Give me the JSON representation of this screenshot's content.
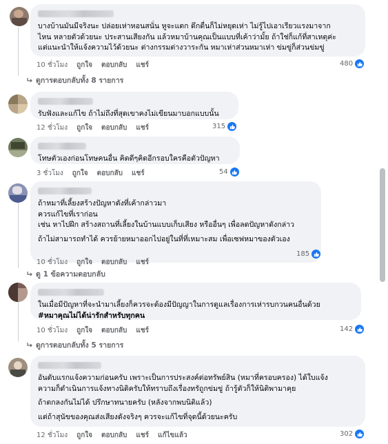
{
  "comments": [
    {
      "paragraphs": [
        "บางบ้านมันมีจริงนะ ปล่อยเห่าหอนสนั่น หูจะแตก ดึกดื่นก็ไม่หยุดเห่า ไม่รู้ไปเอาเรียวแรงมาจาก\nไหน หลายตัวด้วยนะ ประสานเสียงกัน แล้วหมาบ้านคุณเป็นแบบที่เค้าว่ามั้ย ถ้าใช่ก็แก้ที่สาเหตุค่ะ\nแต่แนะนำให้แจ้งความไว้ด้วยนะ ต่างกรรมต่างวาระกัน หมาเห่าส่วนหมาเห่า ข่มขู่ก็ส่วนข่มขู่"
      ],
      "time": "10 ชั่วโมง",
      "like": "ถูกใจ",
      "reply": "ตอบกลับ",
      "share": "แชร์",
      "reactions": "480",
      "more_replies": "ดูการตอบกลับทั้ง 8 รายการ"
    },
    {
      "paragraphs": [
        "รับฟังและแก้ไข ถ้าไม่ถึงที่สุดเขาคงไม่เขียนมาบอกแบบนั้น"
      ],
      "time": "12 ชั่วโมง",
      "like": "ถูกใจ",
      "reply": "ตอบกลับ",
      "share": "แชร์",
      "reactions": "315"
    },
    {
      "paragraphs": [
        "โทษตัวเองก่อนโทษคนอื่น คิดดีๆคิดอีกรอบใครคือตัวปัญหา"
      ],
      "time": "3 ชั่วโมง",
      "like": "ถูกใจ",
      "reply": "ตอบกลับ",
      "share": "แชร์",
      "reactions": "54"
    },
    {
      "paragraphs": [
        "ถ้าหมาที่เลี้ยงสร้างปัญหาดังที่เค้ากล่าวมา\nควรแก้ไขที่เราก่อน\nเช่น หาไปฝึก สร้างสถานที่เลี้ยงในบ้านแบบเก็บเสียง หรืออื่นๆ เพื่อลดปัญหาดังกล่าว",
        "ถ้าไม่สามารถทำได้ ควรย้ายหมาออกไปอยู่ในที่ที่เหมาะสม เพื่อเซฟหมาของตัวเอง"
      ],
      "time": "10 ชั่วโมง",
      "like": "ถูกใจ",
      "reply": "ตอบกลับ",
      "share": "แชร์",
      "reactions": "185",
      "more_replies": "ดู 1 ข้อความตอบกลับ"
    },
    {
      "paragraphs": [
        "ในเมื่อมีปัญหาที่จะนำมาเลี้ยงก็ควรจะต้องมีปัญญาในการดูแลเรื่องการเห่ารบกวนคนอื่นด้วย"
      ],
      "hashtag": "#หมาคุณไม่ได้น่ารักสำหรับทุกคน",
      "time": "10 ชั่วโมง",
      "like": "ถูกใจ",
      "reply": "ตอบกลับ",
      "share": "แชร์",
      "reactions": "142",
      "more_replies": "ดูการตอบกลับทั้ง 5 รายการ"
    },
    {
      "paragraphs": [
        "อันดับแรกแจ้งความก่อนครับ เพราะเป็นการประสงค์ต่อทรัพย์สิน (หมาที่ครอบครอง) ได้ใบแจ้ง\nความก็ดำเนินการแจ้งทางนิติครับให้ทราบถึงเรื่องทรัถูกข่มขู่ ถ้ารู้ตัวก็ให้นิติพามาคุย",
        "ถ้าตกลงกันไม่ได้ ปรึกษาทนายครับ (หลังจากพบนิติแล้ว)",
        "แต่ถ้าสุนัขของคุณส่งเสียงดังจริงๆ ควรจะแก้ไขที่จุดนี้ด้วยนะครับ"
      ],
      "time": "12 ชั่วโมง",
      "like": "ถูกใจ",
      "reply": "ตอบกลับ",
      "share": "แชร์",
      "edited": "แก้ไขแล้ว",
      "reactions": "302"
    }
  ],
  "colors": {
    "like_blue": "#1877f2",
    "bubble": "#f0f2f5",
    "meta": "#65676b"
  }
}
